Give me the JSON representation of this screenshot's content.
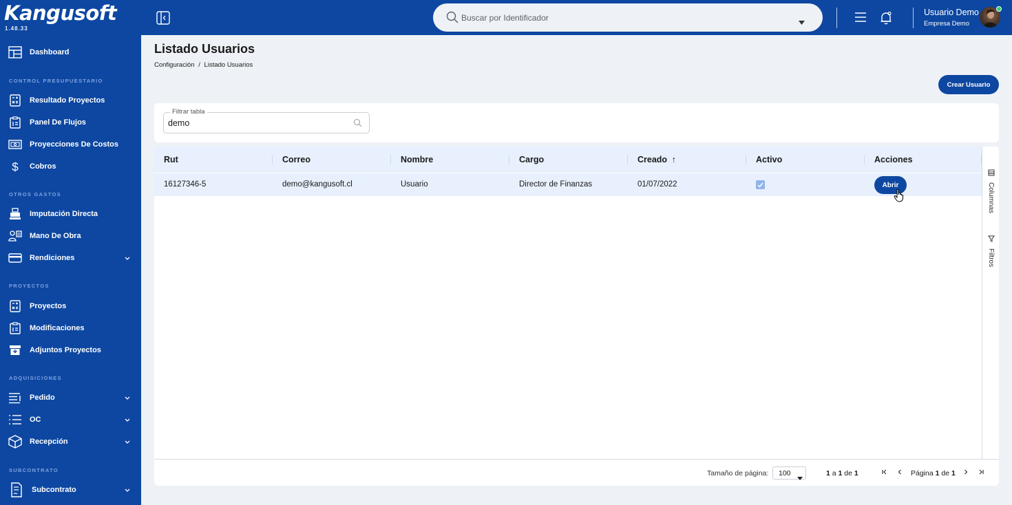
{
  "app": {
    "logo": "Kangusoft",
    "version": "1.48.33"
  },
  "sidebar": {
    "dashboard": "Dashboard",
    "sections": [
      {
        "title": "CONTROL PRESUPUESTARIO"
      },
      {
        "title": "OTROS GASTOS"
      },
      {
        "title": "PROYECTOS"
      },
      {
        "title": "ADQUISICIONES"
      },
      {
        "title": "SUBCONTRATO"
      }
    ],
    "items": [
      {
        "label": "Resultado Proyectos",
        "icon": "calculator-icon"
      },
      {
        "label": "Panel De Flujos",
        "icon": "clipboard-icon"
      },
      {
        "label": "Proyecciones De Costos",
        "icon": "money-icon"
      },
      {
        "label": "Cobros",
        "icon": "dollar-icon"
      },
      {
        "label": "Imputación Directa",
        "icon": "register-icon"
      },
      {
        "label": "Mano De Obra",
        "icon": "workers-icon"
      },
      {
        "label": "Rendiciones",
        "icon": "credit-card-icon"
      },
      {
        "label": "Proyectos",
        "icon": "calculator-icon"
      },
      {
        "label": "Modificaciones",
        "icon": "clipboard-icon"
      },
      {
        "label": "Adjuntos Proyectos",
        "icon": "archive-icon"
      },
      {
        "label": "Pedido",
        "icon": "list-icon"
      },
      {
        "label": "OC",
        "icon": "checklist-icon"
      },
      {
        "label": "Recepción",
        "icon": "box-icon"
      },
      {
        "label": "Subcontrato",
        "icon": "contract-icon"
      }
    ]
  },
  "topbar": {
    "search_placeholder": "Buscar por Identificador",
    "user_name": "Usuario Demo",
    "company": "Empresa Demo"
  },
  "page": {
    "title": "Listado Usuarios",
    "breadcrumb": [
      "Configuración",
      "/",
      "Listado Usuarios"
    ],
    "create_button": "Crear Usuario"
  },
  "filter": {
    "label": "Filtrar tabla",
    "value": "demo"
  },
  "table": {
    "columns": [
      "Rut",
      "Correo",
      "Nombre",
      "Cargo",
      "Creado",
      "Activo",
      "Acciones"
    ],
    "sort_indicator": "↑",
    "rows": [
      {
        "rut": "16127346-5",
        "correo": "demo@kangusoft.cl",
        "nombre": "Usuario",
        "cargo": "Director de Finanzas",
        "creado": "01/07/2022",
        "activo": true,
        "accion": "Abrir"
      }
    ],
    "side_tabs": [
      "Columnas",
      "Filtros"
    ]
  },
  "pagination": {
    "page_size_label": "Tamaño de página:",
    "page_size": "100",
    "range_from": "1",
    "range_a": "a",
    "range_to": "1",
    "range_de": "de",
    "range_total": "1",
    "page_label": "Página",
    "page_current": "1",
    "page_de": "de",
    "page_total": "1"
  },
  "colors": {
    "brand": "#0d47a1",
    "row_highlight": "#e7f0fc",
    "background": "#eef2f6"
  }
}
